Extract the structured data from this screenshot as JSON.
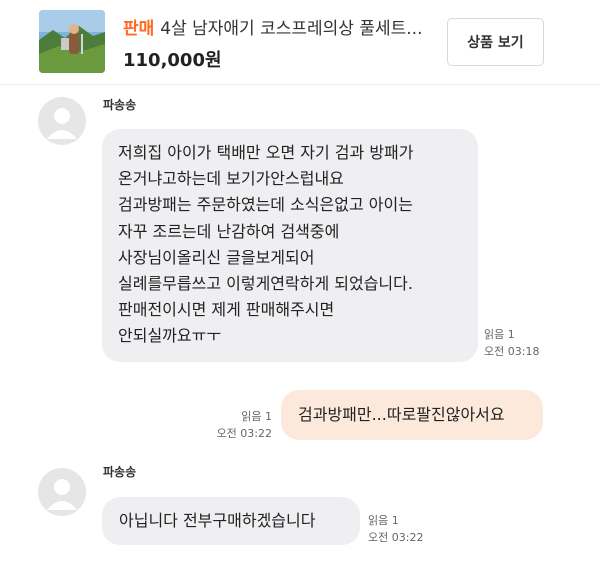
{
  "product": {
    "tag": "판매",
    "name": "4살 남자애기 코스프레의상 풀세트...",
    "price": "110,000원",
    "view_button": "상품 보기",
    "thumbnail_icon": "product-photo"
  },
  "messages": [
    {
      "sender": "파송송",
      "direction": "incoming",
      "lines": [
        "저희집  아이가 택배만 오면  자기 검과 방패가",
        "온거냐고하는데 보기가안스럽내요",
        "검과방패는  주문하였는데 소식은없고 아이는",
        "자꾸 조르는데 난감하여  검색중에",
        "사장님이올리신  글을보게되어",
        "실례를무릅쓰고  이렇게연락하게 되었습니다.",
        "판매전이시면  제게 판매해주시면",
        "안되실까요ㅠㅜ"
      ],
      "read": "읽음 1",
      "time": "오전 03:18"
    },
    {
      "direction": "outgoing",
      "text": "검과방패만...따로팔진않아서요",
      "read": "읽음 1",
      "time": "오전 03:22"
    },
    {
      "sender": "파송송",
      "direction": "incoming",
      "text": "아닙니다  전부구매하겠습니다",
      "read": "읽음 1",
      "time": "오전 03:22"
    }
  ],
  "colors": {
    "accent": "#ff6a1f",
    "incoming_bubble": "#efeef1",
    "outgoing_bubble": "#fce9dc"
  }
}
